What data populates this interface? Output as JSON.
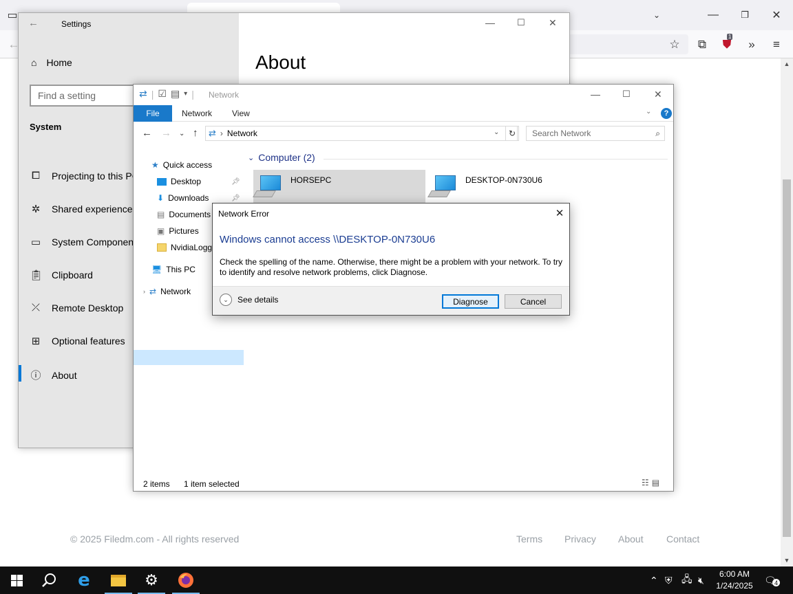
{
  "browser": {
    "footer": {
      "copyright": "© 2025 Filedm.com - All rights reserved",
      "links": [
        "Terms",
        "Privacy",
        "About",
        "Contact"
      ]
    },
    "extension_badge": "1"
  },
  "settings": {
    "title": "Settings",
    "home": "Home",
    "search_placeholder": "Find a setting",
    "section": "System",
    "items": [
      {
        "label": "Projecting to this PC",
        "icon": "projector-icon"
      },
      {
        "label": "Shared experiences",
        "icon": "share-icon"
      },
      {
        "label": "System Components",
        "icon": "components-icon"
      },
      {
        "label": "Clipboard",
        "icon": "clipboard-icon"
      },
      {
        "label": "Remote Desktop",
        "icon": "remote-icon"
      },
      {
        "label": "Optional features",
        "icon": "grid-icon"
      },
      {
        "label": "About",
        "icon": "info-icon"
      }
    ],
    "page_heading": "About"
  },
  "explorer": {
    "title": "Network",
    "tabs": [
      "File",
      "Network",
      "View"
    ],
    "address": "Network",
    "search_placeholder": "Search Network",
    "nav": [
      {
        "label": "Quick access"
      },
      {
        "label": "Desktop"
      },
      {
        "label": "Downloads"
      },
      {
        "label": "Documents"
      },
      {
        "label": "Pictures"
      },
      {
        "label": "NvidiaLogg"
      },
      {
        "label": "This PC"
      },
      {
        "label": "Network"
      }
    ],
    "group": "Computer (2)",
    "computers": [
      "HORSEPC",
      "DESKTOP-0N730U6"
    ],
    "status_count": "2 items",
    "status_selected": "1 item selected"
  },
  "dialog": {
    "title": "Network Error",
    "heading": "Windows cannot access \\\\DESKTOP-0N730U6",
    "message": "Check the spelling of the name. Otherwise, there might be a problem with your network. To try to identify and resolve network problems, click Diagnose.",
    "details": "See details",
    "diagnose": "Diagnose",
    "cancel": "Cancel"
  },
  "taskbar": {
    "time": "6:00 AM",
    "date": "1/24/2025",
    "notifications": "4"
  },
  "colors": {
    "accent": "#0078d7",
    "taskbar": "#101010",
    "dialog_heading": "#1b3d92"
  }
}
